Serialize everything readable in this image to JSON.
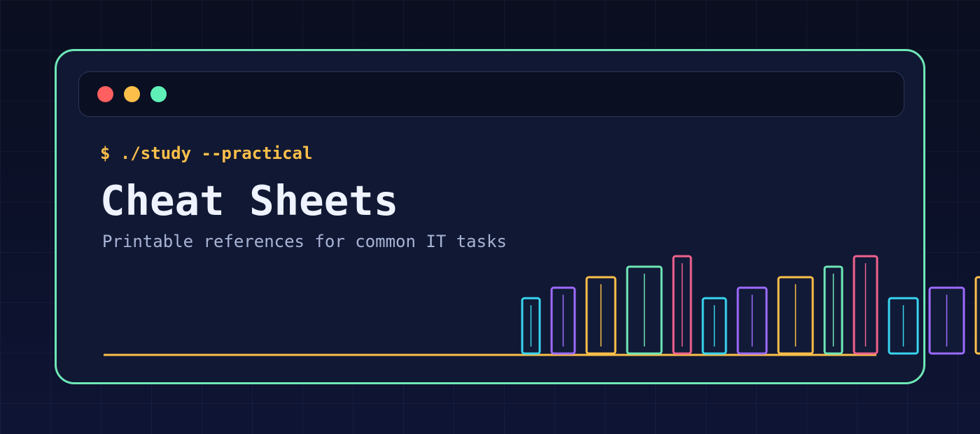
{
  "window": {
    "controls": [
      {
        "name": "close",
        "color": "#ff5f5f"
      },
      {
        "name": "minimize",
        "color": "#fbbf4a"
      },
      {
        "name": "maximize",
        "color": "#5ff0b8"
      }
    ]
  },
  "hero": {
    "prompt": "$ ./study --practical",
    "title": "Cheat Sheets",
    "subtitle": "Printable references for common IT tasks"
  },
  "theme": {
    "accent_border": "#6ee7b7",
    "prompt_color": "#fbbf4a",
    "shelf_color": "#fbbf4a",
    "book_palette": [
      "#38d5f0",
      "#9d6bff",
      "#fbbf4a",
      "#6ee7b7",
      "#f0628f"
    ]
  },
  "bookshelf": {
    "books": [
      {
        "color": "cyan"
      },
      {
        "color": "purple"
      },
      {
        "color": "amber"
      },
      {
        "color": "green"
      },
      {
        "color": "pink"
      },
      {
        "color": "cyan"
      },
      {
        "color": "purple"
      },
      {
        "color": "amber"
      },
      {
        "color": "green"
      },
      {
        "color": "pink"
      },
      {
        "color": "cyan"
      },
      {
        "color": "purple"
      },
      {
        "color": "amber"
      }
    ]
  }
}
